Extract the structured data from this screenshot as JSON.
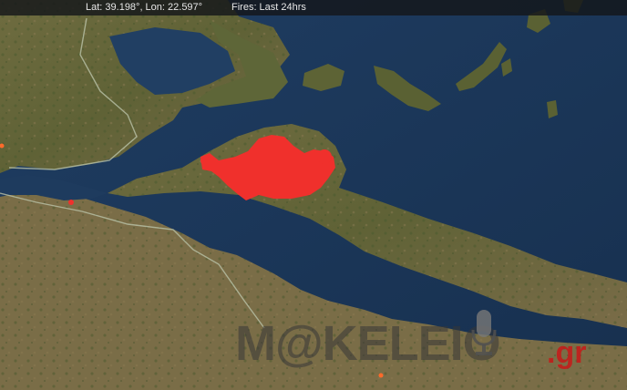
{
  "status_bar": {
    "coordinates": "Lat: 39.198°, Lon: 22.597°",
    "fires_filter": "Fires: Last 24hrs"
  },
  "map": {
    "basemap": "satellite imagery",
    "fire_color": "#f0302c",
    "hotspot_color": "#ff6a2a",
    "sea_color": "#1b3656",
    "land_color": "#6b6a3e"
  },
  "watermark": {
    "text": "M@KELEIO",
    "tld": ".gr",
    "accent_color": "#c81919"
  }
}
